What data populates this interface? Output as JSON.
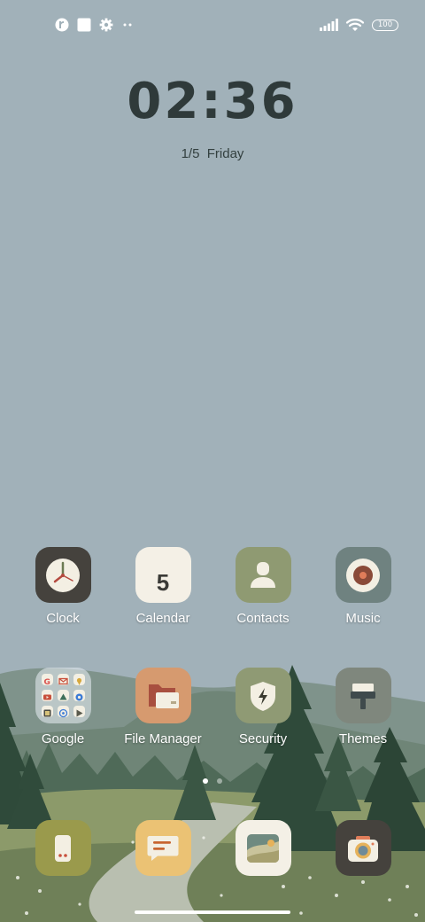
{
  "status_bar": {
    "battery": "100",
    "left_icons": [
      "app-notification-icon",
      "square-notification-icon",
      "settings-gear-icon",
      "more-dots-icon"
    ],
    "right_icons": [
      "signal-icon",
      "wifi-icon",
      "battery-icon"
    ]
  },
  "lockclock": {
    "time": "02:36",
    "date": "1/5  Friday"
  },
  "apps": {
    "clock": {
      "label": "Clock"
    },
    "calendar": {
      "label": "Calendar",
      "day": "5"
    },
    "contacts": {
      "label": "Contacts"
    },
    "music": {
      "label": "Music"
    },
    "google": {
      "label": "Google"
    },
    "file_manager": {
      "label": "File Manager"
    },
    "security": {
      "label": "Security"
    },
    "themes": {
      "label": "Themes"
    }
  },
  "dock": [
    "phone",
    "messages",
    "gallery",
    "camera"
  ],
  "page_indicator": {
    "pages": 2,
    "current": 1
  },
  "colors": {
    "sky": "#a1b1b9",
    "clock_bg": "#45423d",
    "calendar_bg": "#f4f0e6",
    "contacts_bg": "#8f9a72",
    "music_bg": "#6f8280",
    "file_bg": "#d69a6f",
    "security_bg": "#8f9a74",
    "themes_bg": "#7f877d",
    "phone_bg": "#9a9a4c",
    "messages_bg": "#ebc274",
    "gallery_bg": "#f4f0e6",
    "camera_bg": "#45423d"
  }
}
